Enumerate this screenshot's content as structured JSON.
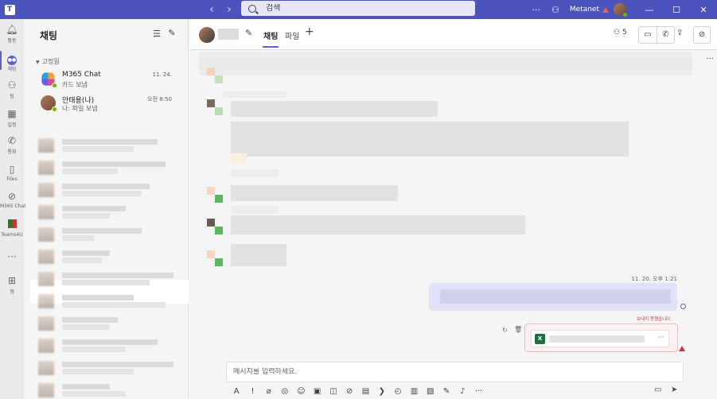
{
  "titlebar": {
    "search_placeholder": "검색",
    "more": "···",
    "org_name": "Metanet",
    "minimize": "—",
    "maximize": "☐",
    "close": "✕"
  },
  "rail": {
    "items": [
      {
        "label": "활동",
        "icon": "bell-icon"
      },
      {
        "label": "채팅",
        "icon": "chat-icon"
      },
      {
        "label": "팀",
        "icon": "teams-icon"
      },
      {
        "label": "일정",
        "icon": "calendar-icon"
      },
      {
        "label": "통화",
        "icon": "phone-icon"
      },
      {
        "label": "Files",
        "icon": "file-icon"
      },
      {
        "label": "M365 Chat",
        "icon": "copilot-icon"
      },
      {
        "label": "Teams4U",
        "icon": "teams4u-icon"
      }
    ],
    "more": "···",
    "apps_label": "앱"
  },
  "chatlist": {
    "title": "채팅",
    "pinned_label": "고정됨",
    "pinned": [
      {
        "name": "M365 Chat",
        "preview": "카드 보냄",
        "time": "11. 24."
      },
      {
        "name": "안태용(나)",
        "preview": "나: 파일 보냄",
        "time": "오전 8:50"
      }
    ]
  },
  "chat_header": {
    "tabs": [
      "채팅",
      "파일"
    ],
    "participants": "5"
  },
  "conversation": {
    "sent_time": "11. 20. 오후 1:21",
    "send_failed": "보내지 못했습니다."
  },
  "compose": {
    "placeholder": "메시지를 입력하세요."
  },
  "colors": {
    "brand": "#4b53bc",
    "accent": "#5b5fc7",
    "error": "#c4314b"
  }
}
